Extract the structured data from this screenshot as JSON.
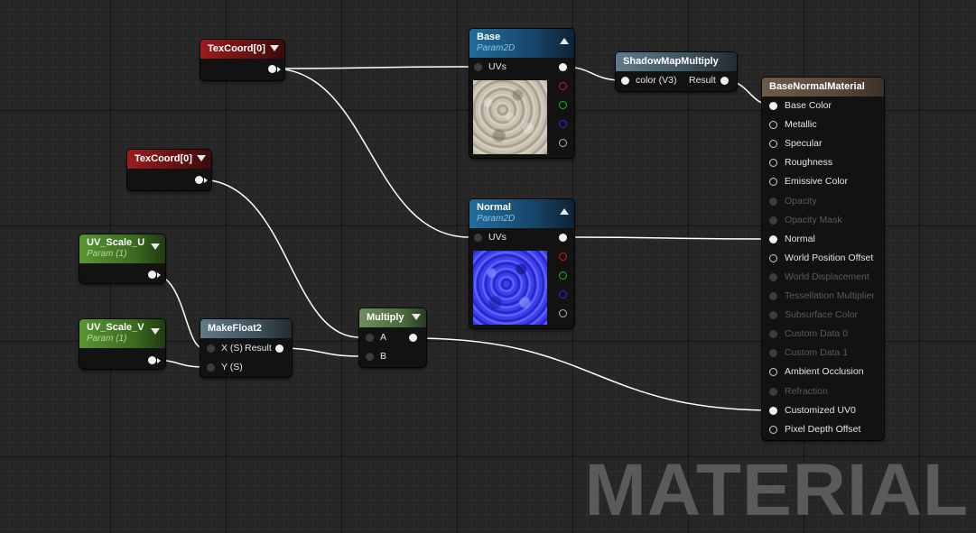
{
  "nodes": {
    "texcoord_1": {
      "title": "TexCoord[0]"
    },
    "texcoord_2": {
      "title": "TexCoord[0]"
    },
    "uv_scale_u": {
      "title": "UV_Scale_U",
      "subtitle": "Param (1)"
    },
    "uv_scale_v": {
      "title": "UV_Scale_V",
      "subtitle": "Param (1)"
    },
    "makefloat2": {
      "title": "MakeFloat2",
      "inputs": [
        "X (S)",
        "Y (S)"
      ],
      "output": "Result"
    },
    "multiply": {
      "title": "Multiply",
      "inputs": [
        "A",
        "B"
      ]
    },
    "base": {
      "title": "Base",
      "subtitle": "Param2D",
      "input": "UVs"
    },
    "normal": {
      "title": "Normal",
      "subtitle": "Param2D",
      "input": "UVs"
    },
    "shadowmap": {
      "title": "ShadowMapMultiply",
      "input": "color (V3)",
      "output": "Result"
    },
    "material": {
      "title": "BaseNormalMaterial",
      "pins": [
        {
          "label": "Base Color",
          "state": "connected"
        },
        {
          "label": "Metallic",
          "state": "enabled"
        },
        {
          "label": "Specular",
          "state": "enabled"
        },
        {
          "label": "Roughness",
          "state": "enabled"
        },
        {
          "label": "Emissive Color",
          "state": "enabled"
        },
        {
          "label": "Opacity",
          "state": "disabled"
        },
        {
          "label": "Opacity Mask",
          "state": "disabled"
        },
        {
          "label": "Normal",
          "state": "connected"
        },
        {
          "label": "World Position Offset",
          "state": "enabled"
        },
        {
          "label": "World Displacement",
          "state": "disabled"
        },
        {
          "label": "Tessellation Multiplier",
          "state": "disabled"
        },
        {
          "label": "Subsurface Color",
          "state": "disabled"
        },
        {
          "label": "Custom Data 0",
          "state": "disabled"
        },
        {
          "label": "Custom Data 1",
          "state": "disabled"
        },
        {
          "label": "Ambient Occlusion",
          "state": "enabled"
        },
        {
          "label": "Refraction",
          "state": "disabled"
        },
        {
          "label": "Customized UV0",
          "state": "connected"
        },
        {
          "label": "Pixel Depth Offset",
          "state": "enabled"
        }
      ]
    }
  },
  "watermark": "MATERIAL",
  "colors": {
    "wire": "#ffffff",
    "pin_red": "#d01a1a",
    "pin_green": "#19c119",
    "pin_blue": "#2a2ad4"
  }
}
